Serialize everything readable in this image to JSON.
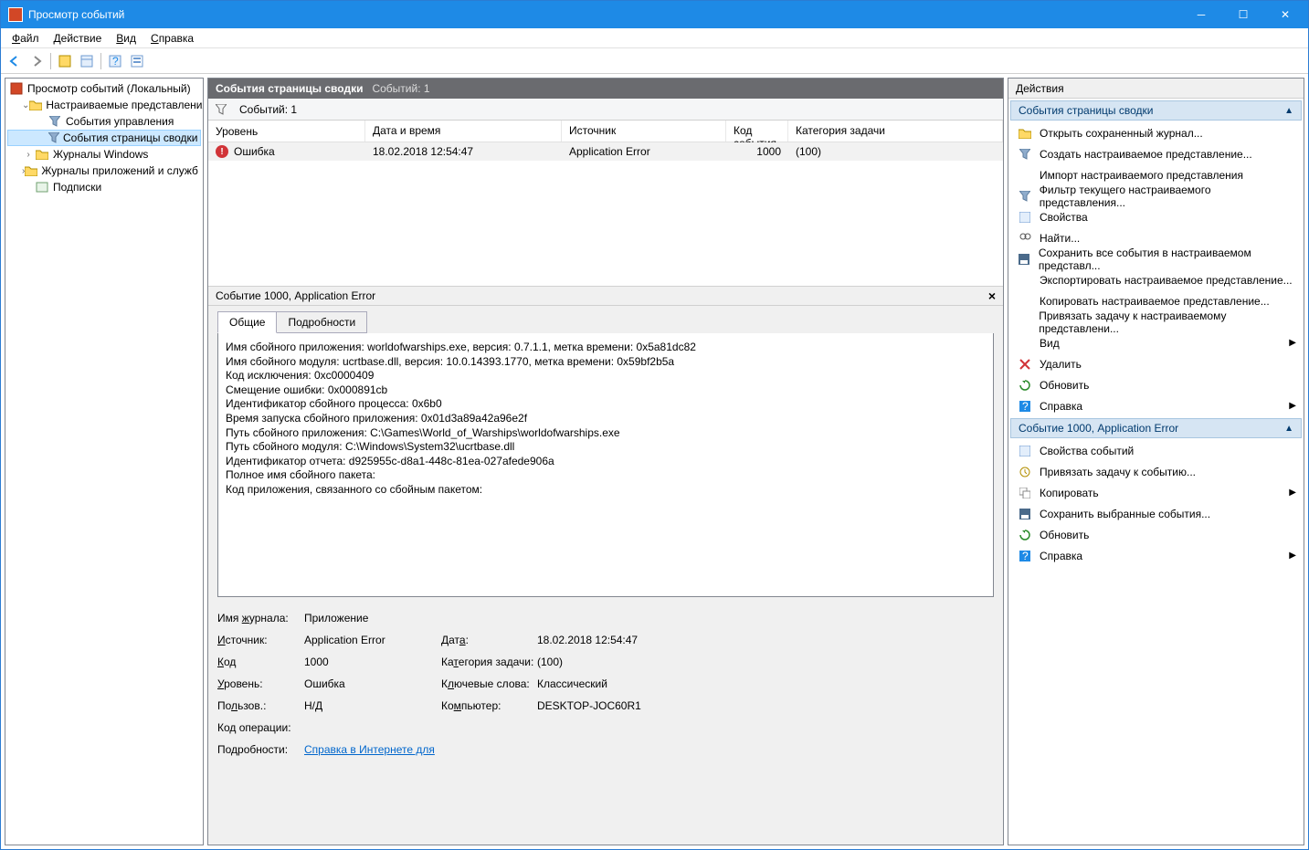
{
  "window": {
    "title": "Просмотр событий"
  },
  "menu": {
    "file": "Файл",
    "action": "Действие",
    "view": "Вид",
    "help": "Справка"
  },
  "tree": {
    "root": "Просмотр событий (Локальный)",
    "custom_views": "Настраиваемые представления",
    "admin_events": "События управления",
    "summary_events": "События страницы сводки",
    "win_logs": "Журналы Windows",
    "app_logs": "Журналы приложений и служб",
    "subscriptions": "Подписки"
  },
  "center": {
    "header_label": "События страницы сводки",
    "header_count": "Событий: 1",
    "filter_count": "Событий: 1",
    "columns": {
      "level": "Уровень",
      "date": "Дата и время",
      "source": "Источник",
      "code": "Код события",
      "cat": "Категория задачи"
    },
    "row": {
      "level": "Ошибка",
      "date": "18.02.2018 12:54:47",
      "source": "Application Error",
      "code": "1000",
      "cat": "(100)"
    },
    "detail_title": "Событие 1000, Application Error",
    "tab_general": "Общие",
    "tab_details": "Подробности",
    "detail_text": "Имя сбойного приложения: worldofwarships.exe, версия: 0.7.1.1, метка времени: 0x5a81dc82\nИмя сбойного модуля: ucrtbase.dll, версия: 10.0.14393.1770, метка времени: 0x59bf2b5a\nКод исключения: 0xc0000409\nСмещение ошибки: 0x000891cb\nИдентификатор сбойного процесса: 0x6b0\nВремя запуска сбойного приложения: 0x01d3a89a42a96e2f\nПуть сбойного приложения: C:\\Games\\World_of_Warships\\worldofwarships.exe\nПуть сбойного модуля: C:\\Windows\\System32\\ucrtbase.dll\nИдентификатор отчета: d925955c-d8a1-448c-81ea-027afede906a\nПолное имя сбойного пакета:\nКод приложения, связанного со сбойным пакетом:",
    "grid": {
      "log_name_l": "Имя журнала:",
      "log_name_v": "Приложение",
      "source_l": "Источник:",
      "source_v": "Application Error",
      "date_l": "Дата:",
      "date_v": "18.02.2018 12:54:47",
      "code_l": "Код",
      "code_v": "1000",
      "cat_l": "Категория задачи:",
      "cat_v": "(100)",
      "level_l": "Уровень:",
      "level_v": "Ошибка",
      "keywords_l": "Ключевые слова:",
      "keywords_v": "Классический",
      "user_l": "Пользов.:",
      "user_v": "Н/Д",
      "computer_l": "Компьютер:",
      "computer_v": "DESKTOP-JOC60R1",
      "opcode_l": "Код операции:",
      "details_l": "Подробности:",
      "details_link": "Справка в Интернете для"
    }
  },
  "actions": {
    "header": "Действия",
    "section1": "События страницы сводки",
    "items1": [
      "Открыть сохраненный журнал...",
      "Создать настраиваемое представление...",
      "Импорт настраиваемого представления",
      "Фильтр текущего настраиваемого представления...",
      "Свойства",
      "Найти...",
      "Сохранить все события в настраиваемом представл...",
      "Экспортировать настраиваемое представление...",
      "Копировать настраиваемое представление...",
      "Привязать задачу к настраиваемому представлени..."
    ],
    "view": "Вид",
    "delete": "Удалить",
    "refresh": "Обновить",
    "help": "Справка",
    "section2": "Событие 1000, Application Error",
    "items2": [
      "Свойства событий",
      "Привязать задачу к событию..."
    ],
    "copy": "Копировать",
    "save_sel": "Сохранить выбранные события...",
    "refresh2": "Обновить",
    "help2": "Справка"
  }
}
